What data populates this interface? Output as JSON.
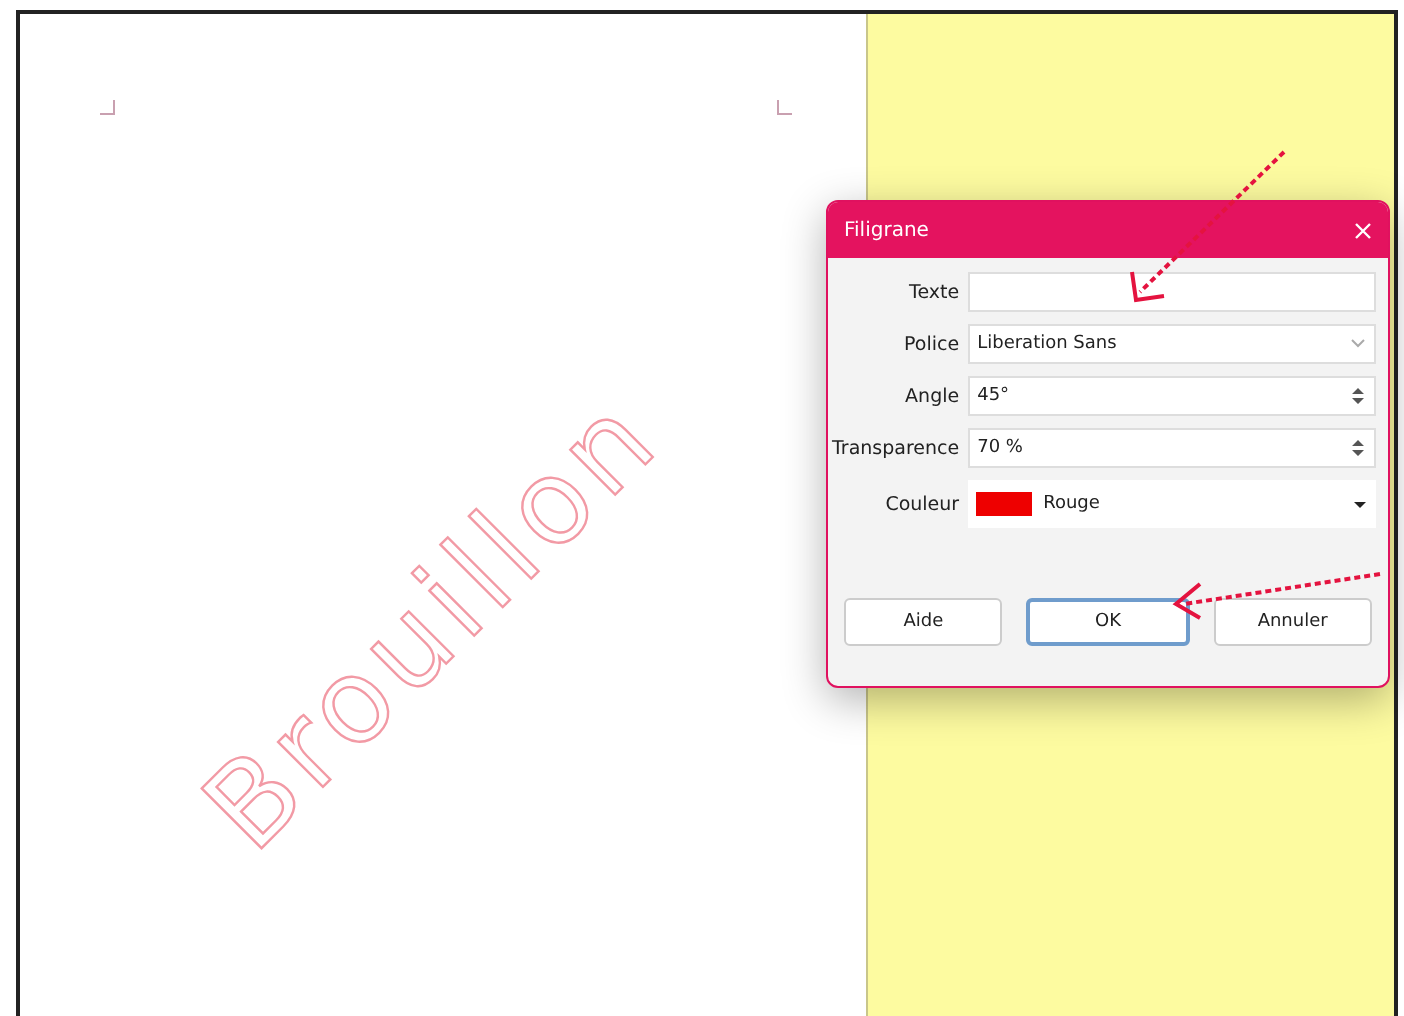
{
  "document": {
    "watermark": "Brouillon"
  },
  "dialog": {
    "title": "Filigrane",
    "fields": [
      {
        "kind": "text",
        "label": "Texte"
      },
      {
        "kind": "combo",
        "label": "Police",
        "value": "Liberation Sans"
      },
      {
        "kind": "spin",
        "label": "Angle",
        "value": "45°"
      },
      {
        "kind": "spin",
        "label": "Transparence",
        "value": "70 %"
      },
      {
        "kind": "color",
        "label": "Couleur",
        "value": "Rouge",
        "color": "#ee0000"
      }
    ],
    "buttons": [
      {
        "label": "Aide",
        "selected": false
      },
      {
        "label": "OK",
        "selected": true
      },
      {
        "label": "Annuler",
        "selected": false
      }
    ]
  }
}
